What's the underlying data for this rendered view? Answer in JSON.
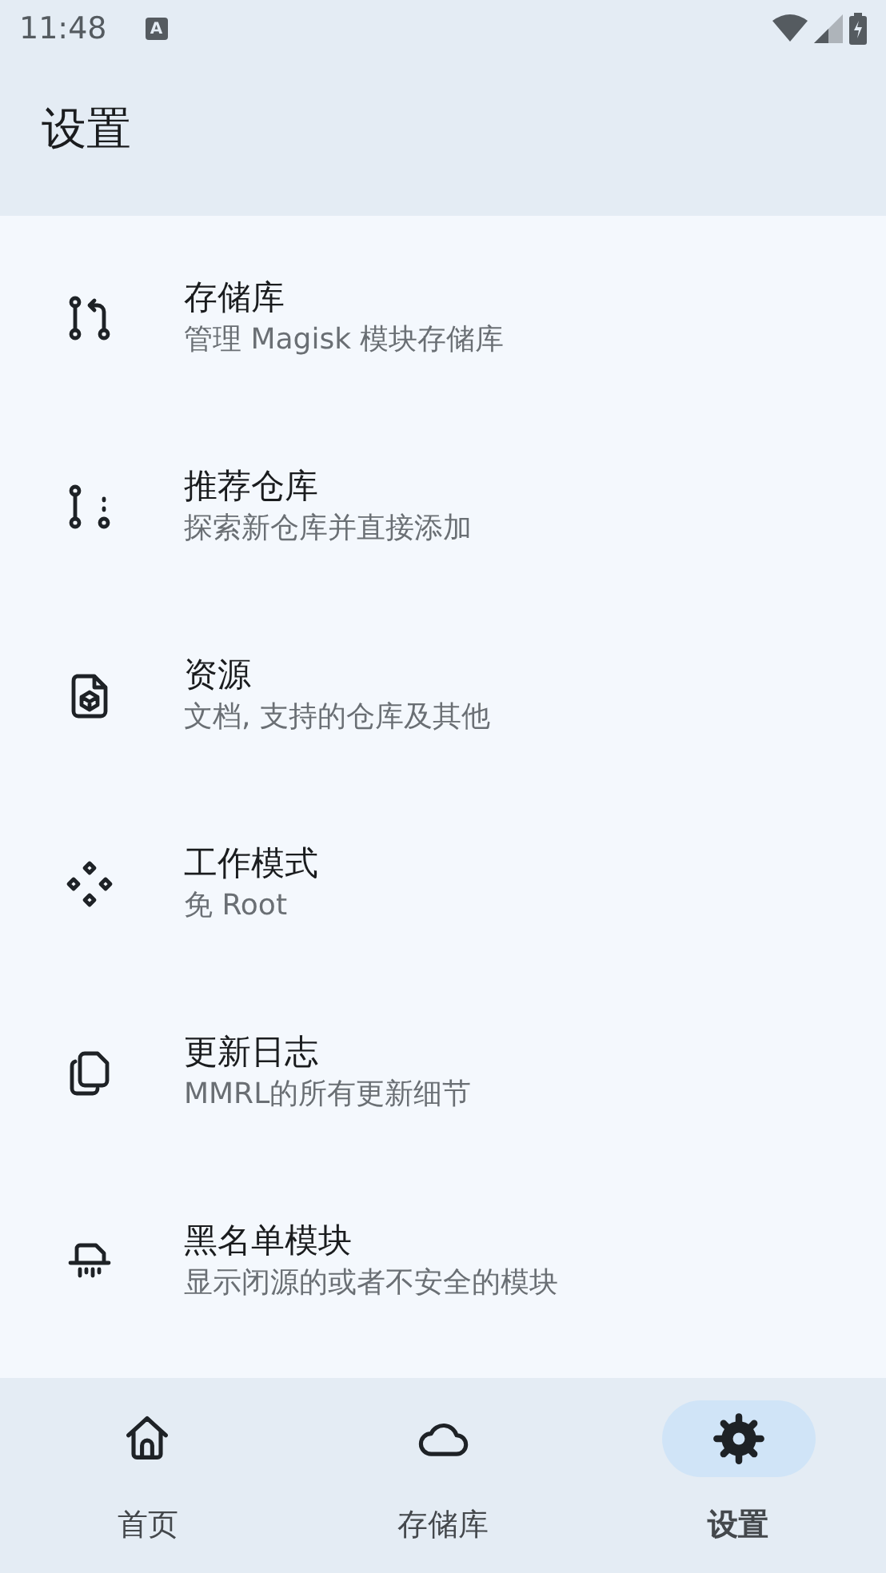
{
  "status_bar": {
    "time": "11:48",
    "notification_glyph": "A"
  },
  "app_bar": {
    "title": "设置"
  },
  "settings": [
    {
      "title": "存储库",
      "subtitle": "管理 Magisk 模块存储库"
    },
    {
      "title": "推荐仓库",
      "subtitle": "探索新仓库并直接添加"
    },
    {
      "title": "资源",
      "subtitle": "文档, 支持的仓库及其他"
    },
    {
      "title": "工作模式",
      "subtitle": "免 Root"
    },
    {
      "title": "更新日志",
      "subtitle": "MMRL的所有更新细节"
    },
    {
      "title": "黑名单模块",
      "subtitle": "显示闭源的或者不安全的模块"
    }
  ],
  "bottom_nav": [
    {
      "label": "首页",
      "selected": false
    },
    {
      "label": "存储库",
      "selected": false
    },
    {
      "label": "设置",
      "selected": true
    }
  ]
}
